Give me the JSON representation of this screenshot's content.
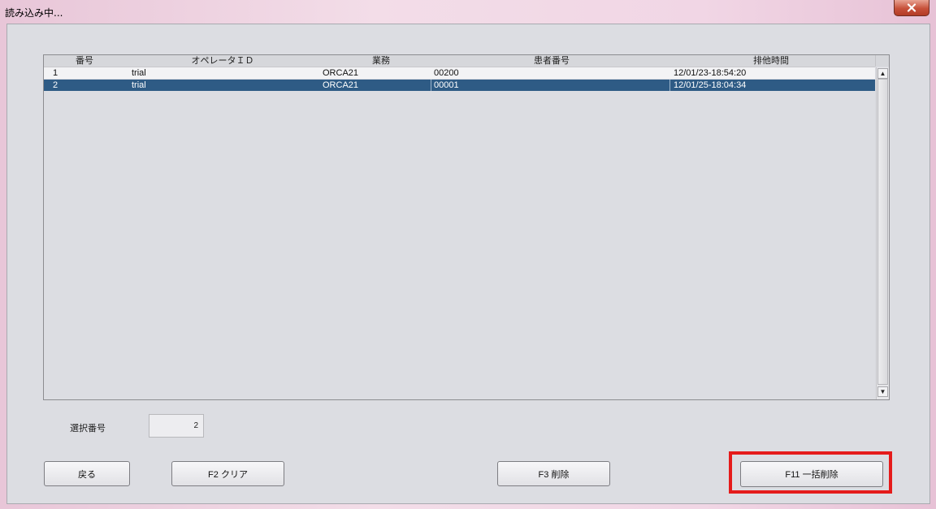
{
  "window": {
    "title": "読み込み中..."
  },
  "table": {
    "columns": [
      "番号",
      "オペレータＩＤ",
      "業務",
      "患者番号",
      "排他時間"
    ],
    "rows": [
      {
        "no": "1",
        "operator": "trial",
        "business": "ORCA21",
        "patient": "00200",
        "time": "12/01/23-18:54:20"
      },
      {
        "no": "2",
        "operator": "trial",
        "business": "ORCA21",
        "patient": "00001",
        "time": "12/01/25-18:04:34"
      }
    ],
    "selected_row": "2"
  },
  "selection": {
    "label": "選択番号",
    "value": "2"
  },
  "buttons": {
    "back": "戻る",
    "clear": "F2 クリア",
    "delete": "F3 削除",
    "bulk_delete": "F11 一括削除"
  },
  "colors": {
    "selected_row": "#2e5b85",
    "highlight": "#e51b1b",
    "close_button": "#c7503a"
  },
  "icons": {
    "close": "close-icon",
    "scroll_up": "arrow-up-icon",
    "scroll_down": "arrow-down-icon"
  }
}
